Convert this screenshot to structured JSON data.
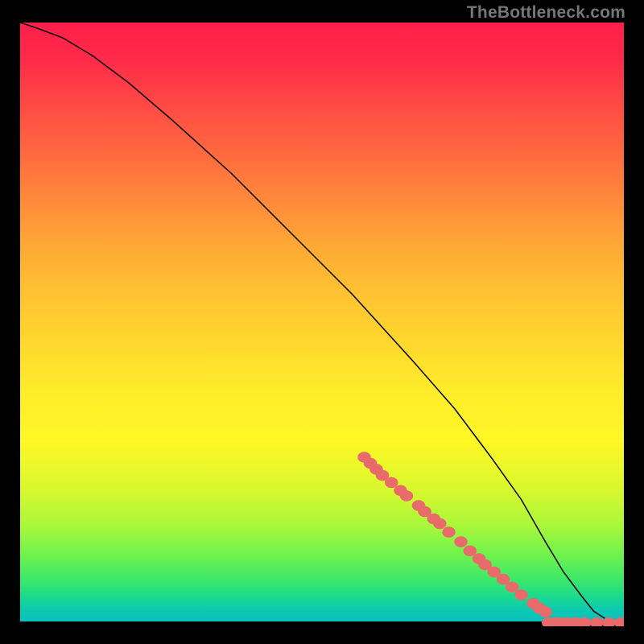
{
  "watermark": "TheBottleneck.com",
  "chart_data": {
    "type": "line",
    "title": "",
    "xlabel": "",
    "ylabel": "",
    "xlim": [
      0,
      100
    ],
    "ylim": [
      0,
      100
    ],
    "grid": false,
    "series": [
      {
        "name": "curve",
        "x": [
          0,
          3,
          7,
          12,
          18,
          25,
          35,
          45,
          55,
          65,
          72,
          78,
          83,
          87,
          90,
          93,
          95,
          97,
          99,
          100
        ],
        "y": [
          100,
          99,
          97.5,
          94.5,
          90,
          84,
          75,
          65,
          55,
          44,
          36,
          28,
          21,
          14,
          9,
          5,
          2.5,
          1.2,
          0.6,
          0.4
        ]
      }
    ],
    "points": {
      "name": "dots",
      "x": [
        57,
        58,
        59,
        60,
        61.5,
        63,
        64,
        66,
        67,
        68.5,
        69.5,
        71,
        73,
        74.5,
        76,
        77,
        78.5,
        80,
        81.5,
        83,
        85,
        86,
        87,
        87.5,
        88.5,
        89.2,
        90.5,
        92,
        93.5,
        95.5,
        97.5,
        99.5
      ],
      "y": [
        28,
        27,
        26,
        25,
        23.8,
        22.5,
        21.6,
        20,
        19,
        17.8,
        17,
        15.6,
        14,
        12.5,
        11.2,
        10.2,
        9,
        7.8,
        6.5,
        5.2,
        3.8,
        3,
        2.4,
        0.6,
        0.6,
        0.6,
        0.6,
        0.6,
        0.6,
        0.6,
        0.6,
        0.6
      ]
    },
    "point_color": "#e86a6a",
    "curve_color": "#000000"
  }
}
